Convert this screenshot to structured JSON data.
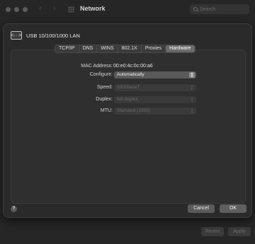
{
  "window": {
    "title": "Network",
    "search_placeholder": "Search",
    "revert_label": "Revert",
    "apply_label": "Apply"
  },
  "sheet": {
    "interface_name": "USB 10/100/1000 LAN",
    "interface_icon": "<···>",
    "tabs": [
      {
        "label": "TCP/IP"
      },
      {
        "label": "DNS"
      },
      {
        "label": "WINS"
      },
      {
        "label": "802.1X"
      },
      {
        "label": "Proxies"
      },
      {
        "label": "Hardware"
      }
    ],
    "active_tab": "Hardware",
    "mac_label": "MAC Address:",
    "mac_value": "00:e0:4c:0c:00:a6",
    "configure_label": "Configure:",
    "configure_value": "Automatically",
    "speed_label": "Speed:",
    "speed_value": "1000baseT",
    "duplex_label": "Duplex:",
    "duplex_value": "full-duplex",
    "mtu_label": "MTU:",
    "mtu_value": "Standard (1500)",
    "help_label": "?",
    "cancel_label": "Cancel",
    "ok_label": "OK"
  }
}
